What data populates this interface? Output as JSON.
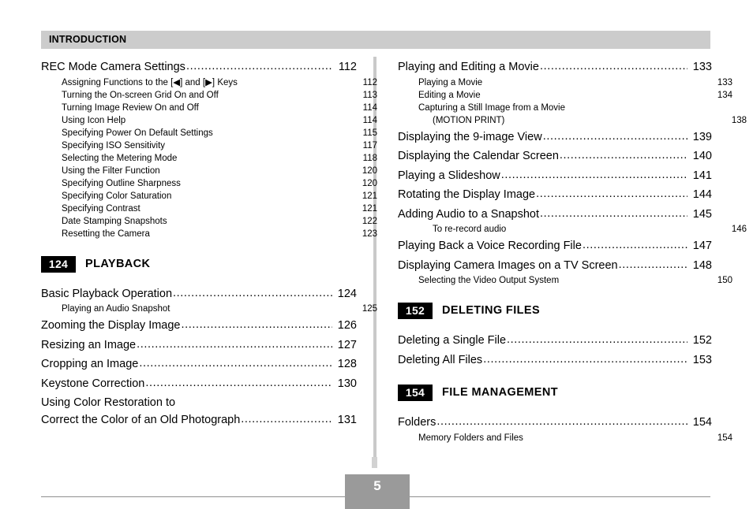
{
  "header": {
    "chapter_label": "INTRODUCTION"
  },
  "footer": {
    "page_number": "5"
  },
  "left_column": {
    "blocks": [
      {
        "type": "entries",
        "entries": [
          {
            "level": 1,
            "label": "REC Mode Camera Settings",
            "page": "112"
          },
          {
            "level": 2,
            "label": "Assigning Functions to the [◀] and [▶] Keys",
            "page": "112"
          },
          {
            "level": 2,
            "label": "Turning the On-screen Grid On and Off",
            "page": "113"
          },
          {
            "level": 2,
            "label": "Turning Image Review On and Off",
            "page": "114"
          },
          {
            "level": 2,
            "label": "Using Icon Help",
            "page": "114"
          },
          {
            "level": 2,
            "label": "Specifying Power On Default Settings",
            "page": "115"
          },
          {
            "level": 2,
            "label": "Specifying ISO Sensitivity",
            "page": "117"
          },
          {
            "level": 2,
            "label": "Selecting the Metering Mode",
            "page": "118"
          },
          {
            "level": 2,
            "label": "Using the Filter Function",
            "page": "120"
          },
          {
            "level": 2,
            "label": "Specifying Outline Sharpness",
            "page": "120"
          },
          {
            "level": 2,
            "label": "Specifying Color Saturation",
            "page": "121"
          },
          {
            "level": 2,
            "label": "Specifying Contrast",
            "page": "121"
          },
          {
            "level": 2,
            "label": "Date Stamping Snapshots",
            "page": "122"
          },
          {
            "level": 2,
            "label": "Resetting the Camera",
            "page": "123"
          }
        ]
      },
      {
        "type": "section",
        "badge": "124",
        "title": "PLAYBACK"
      },
      {
        "type": "entries",
        "entries": [
          {
            "level": 1,
            "label": "Basic Playback Operation",
            "page": "124"
          },
          {
            "level": 2,
            "label": "Playing an Audio Snapshot",
            "page": "125"
          },
          {
            "level": 1,
            "label": "Zooming the Display Image",
            "page": "126"
          },
          {
            "level": 1,
            "label": "Resizing an Image",
            "page": "127"
          },
          {
            "level": 1,
            "label": "Cropping an Image",
            "page": "128"
          },
          {
            "level": 1,
            "label": "Keystone Correction",
            "page": "130"
          },
          {
            "level": 1,
            "label": "Using Color Restoration to",
            "label2": "Correct the Color of an Old Photograph",
            "page": "131",
            "wrap": true
          }
        ]
      }
    ]
  },
  "right_column": {
    "blocks": [
      {
        "type": "entries",
        "entries": [
          {
            "level": 1,
            "label": "Playing and Editing a Movie",
            "page": "133"
          },
          {
            "level": 2,
            "label": "Playing a Movie",
            "page": "133"
          },
          {
            "level": 2,
            "label": "Editing a Movie",
            "page": "134"
          },
          {
            "level": 2,
            "label": "Capturing a Still Image from a Movie",
            "page": ""
          },
          {
            "level": 3,
            "label": "(MOTION PRINT)",
            "page": "138"
          },
          {
            "level": 1,
            "label": "Displaying the 9-image View",
            "page": "139"
          },
          {
            "level": 1,
            "label": "Displaying the Calendar Screen",
            "page": "140"
          },
          {
            "level": 1,
            "label": "Playing a Slideshow",
            "page": "141"
          },
          {
            "level": 1,
            "label": "Rotating the Display Image",
            "page": "144"
          },
          {
            "level": 1,
            "label": "Adding Audio to a Snapshot",
            "page": "145"
          },
          {
            "level": 3,
            "label": "To re-record audio",
            "page": "146"
          },
          {
            "level": 1,
            "label": "Playing Back a Voice Recording File",
            "page": "147"
          },
          {
            "level": 1,
            "label": "Displaying Camera Images on a TV Screen",
            "page": "148"
          },
          {
            "level": 2,
            "label": "Selecting the Video Output System",
            "page": "150"
          }
        ]
      },
      {
        "type": "section",
        "badge": "152",
        "title": "DELETING FILES"
      },
      {
        "type": "entries",
        "entries": [
          {
            "level": 1,
            "label": "Deleting a Single File",
            "page": "152"
          },
          {
            "level": 1,
            "label": "Deleting All Files",
            "page": "153"
          }
        ]
      },
      {
        "type": "section",
        "badge": "154",
        "title": "FILE MANAGEMENT"
      },
      {
        "type": "entries",
        "entries": [
          {
            "level": 1,
            "label": "Folders",
            "page": "154"
          },
          {
            "level": 2,
            "label": "Memory Folders and Files",
            "page": "154"
          }
        ]
      }
    ]
  },
  "colors": {
    "header_band": "#cccccc",
    "badge_bg": "#000000",
    "footer_box": "#9a9a9a",
    "divider": "#c9c9c9"
  }
}
